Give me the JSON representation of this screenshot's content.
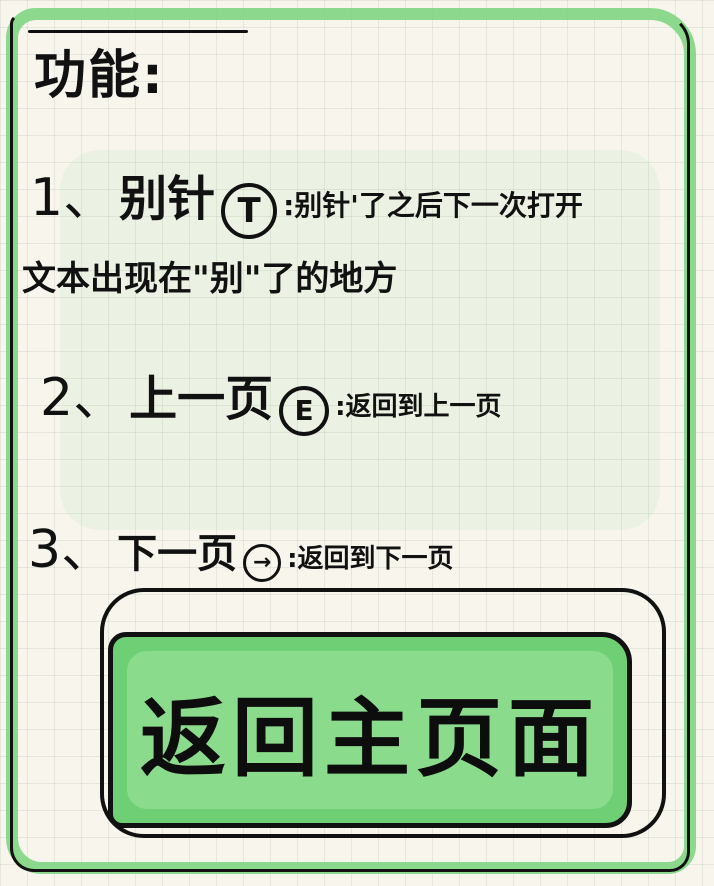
{
  "title": "功能:",
  "items": [
    {
      "number": "1、",
      "label": "别针",
      "key": "T",
      "description_line1": ":别针'了之后下一次打开",
      "description_line2": "文本出现在\"别\"了的地方"
    },
    {
      "number": "2、",
      "label": "上一页",
      "key": "E",
      "description": ":返回到上一页"
    },
    {
      "number": "3、",
      "label": "下一页",
      "key": "→",
      "description": ":返回到下一页"
    }
  ],
  "home_button": {
    "label": "返回主页面"
  },
  "colors": {
    "accent_green": "#6fcf74",
    "frame_green": "#79d37e",
    "ink": "#111111",
    "paper": "#f7f5ec"
  }
}
